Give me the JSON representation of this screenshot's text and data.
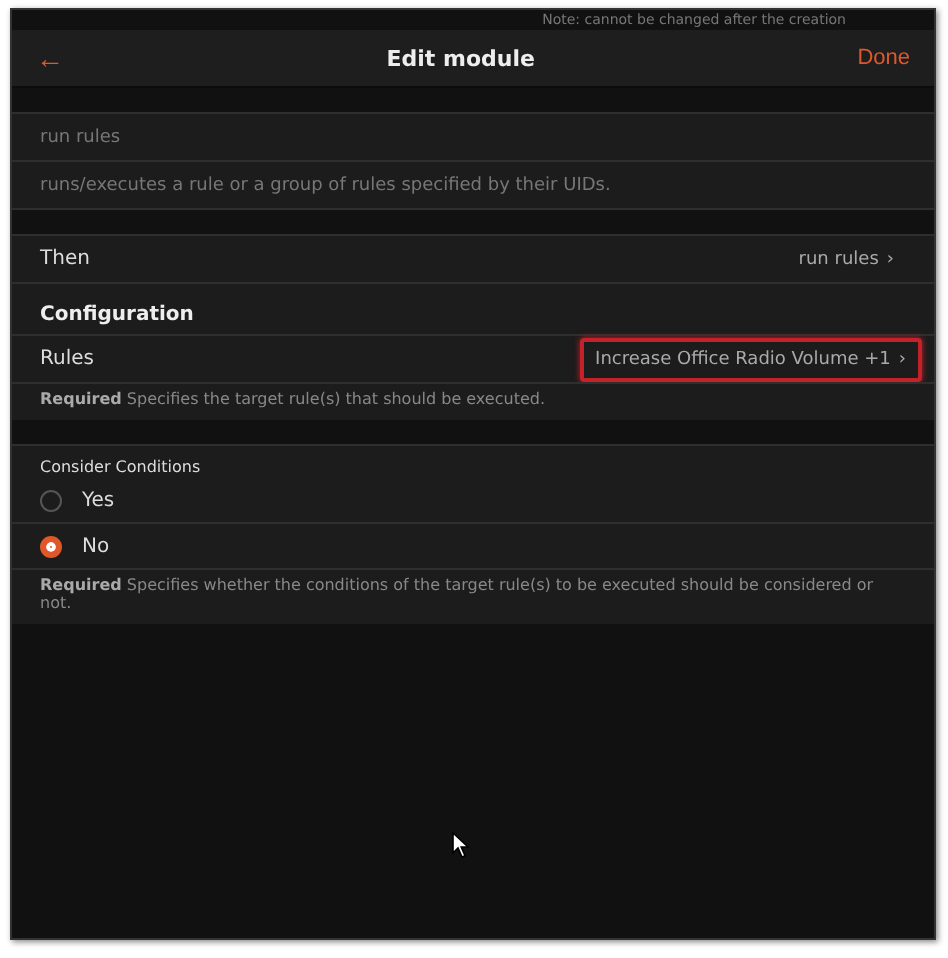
{
  "note": "Note: cannot be changed after the creation",
  "header": {
    "back": "←",
    "title": "Edit module",
    "done": "Done"
  },
  "fields": [
    {
      "value": "run rules"
    },
    {
      "value": "runs/executes a rule or a group of rules specified by their UIDs."
    }
  ],
  "then": {
    "label": "Then",
    "value": "run rules",
    "chevron": "›"
  },
  "configuration": {
    "title": "Configuration",
    "rules": {
      "label": "Rules",
      "value": "Increase Office Radio Volume +1",
      "chevron": "›",
      "highlighted": true,
      "help_strong": "Required",
      "help": "Specifies the target rule(s) that should be executed."
    },
    "consider": {
      "label": "Consider Conditions",
      "options": [
        {
          "label": "Yes",
          "selected": false
        },
        {
          "label": "No",
          "selected": true
        }
      ],
      "help_strong": "Required",
      "help": "Specifies whether the conditions of the target rule(s) to be executed should be considered or not."
    }
  }
}
